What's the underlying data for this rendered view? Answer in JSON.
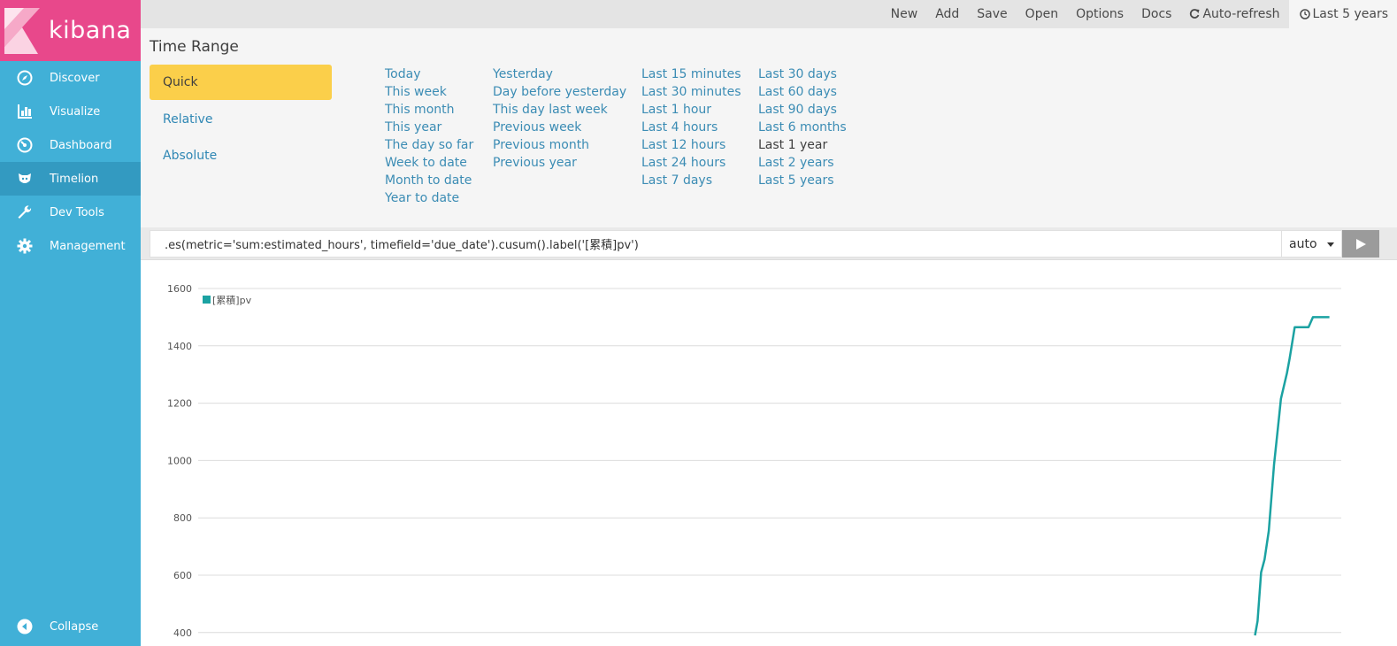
{
  "app": {
    "name": "kibana"
  },
  "sidebar": {
    "items": [
      {
        "label": "Discover",
        "icon": "compass-icon",
        "active": false
      },
      {
        "label": "Visualize",
        "icon": "bar-chart-icon",
        "active": false
      },
      {
        "label": "Dashboard",
        "icon": "dashboard-icon",
        "active": false
      },
      {
        "label": "Timelion",
        "icon": "timelion-icon",
        "active": true
      },
      {
        "label": "Dev Tools",
        "icon": "wrench-icon",
        "active": false
      },
      {
        "label": "Management",
        "icon": "gear-icon",
        "active": false
      }
    ],
    "collapse_label": "Collapse"
  },
  "topbar": {
    "new": "New",
    "add": "Add",
    "save": "Save",
    "open": "Open",
    "options": "Options",
    "docs": "Docs",
    "auto_refresh": "Auto-refresh",
    "time": "Last 5 years"
  },
  "time_range": {
    "title": "Time Range",
    "modes": [
      "Quick",
      "Relative",
      "Absolute"
    ],
    "active_mode": "Quick",
    "quick": [
      [
        "Today",
        "This week",
        "This month",
        "This year",
        "The day so far",
        "Week to date",
        "Month to date",
        "Year to date"
      ],
      [
        "Yesterday",
        "Day before yesterday",
        "This day last week",
        "Previous week",
        "Previous month",
        "Previous year"
      ],
      [
        "Last 15 minutes",
        "Last 30 minutes",
        "Last 1 hour",
        "Last 4 hours",
        "Last 12 hours",
        "Last 24 hours",
        "Last 7 days"
      ],
      [
        "Last 30 days",
        "Last 60 days",
        "Last 90 days",
        "Last 6 months",
        "Last 1 year",
        "Last 2 years",
        "Last 5 years"
      ]
    ]
  },
  "expression": {
    "value": ".es(metric='sum:estimated_hours', timefield='due_date').cusum().label('[累積]pv')",
    "interval": "auto"
  },
  "colors": {
    "series": "#1ba2a2",
    "sidebar": "#41b0d7",
    "logo_bg": "#e8488b",
    "quick_active": "#fbcf4a",
    "link": "#3b8cb4"
  },
  "chart_data": {
    "type": "line",
    "y_ticks": [
      400,
      600,
      800,
      1000,
      1200,
      1400,
      1600
    ],
    "ylim": [
      400,
      1600
    ],
    "xlim": [
      0,
      1
    ],
    "grid": true,
    "legend": "top-left",
    "series": [
      {
        "name": "[累積]pv",
        "color": "#1ba2a2",
        "x": [
          0.9245,
          0.9268,
          0.9299,
          0.9329,
          0.9366,
          0.9412,
          0.9457,
          0.9472,
          0.9525,
          0.9548,
          0.9593,
          0.9639,
          0.9714,
          0.9752,
          0.9896
        ],
        "y": [
          390,
          440,
          610,
          655,
          755,
          985,
          1155,
          1215,
          1305,
          1355,
          1465,
          1465,
          1465,
          1500,
          1500
        ]
      }
    ]
  }
}
